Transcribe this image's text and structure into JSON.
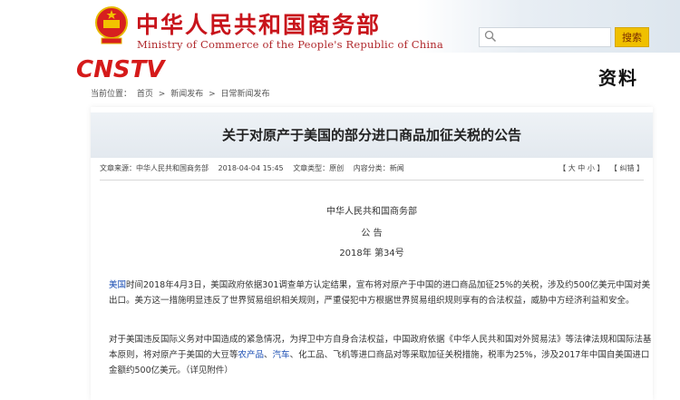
{
  "site": {
    "title": "中华人民共和国商务部",
    "subtitle": "Ministry of Commerce of the People's Republic of China"
  },
  "search": {
    "placeholder": "",
    "button_label": "搜索"
  },
  "overlay": {
    "logo_text": "CNSTV",
    "caption": "资料"
  },
  "breadcrumb": {
    "items": [
      "当前位置：",
      "首页",
      ">",
      "新闻发布",
      ">",
      "日常新闻发布"
    ]
  },
  "article": {
    "title": "关于对原产于美国的部分进口商品加征关税的公告",
    "meta": {
      "source": "文章来源：中华人民共和国商务部",
      "date": "2018-04-04 15:45",
      "type": "文章类型：原创",
      "category": "内容分类：新闻"
    },
    "tools": [
      "【 大 中 小 】",
      "【 纠错 】"
    ],
    "org": "中华人民共和国商务部",
    "heading": "公 告",
    "doc_no": "2018年 第34号",
    "p1_link": "美国",
    "p1_text": "时间2018年4月3日，美国政府依据301调查单方认定结果，宣布将对原产于中国的进口商品加征25%的关税，涉及约500亿美元中国对美出口。美方这一措施明显违反了世界贸易组织相关规则，严重侵犯中方根据世界贸易组织规则享有的合法权益，威胁中方经济利益和安全。",
    "p2_a": "对于美国违反国际义务对中国造成的紧急情况，为捍卫中方自身合法权益，中国政府依据《中华人民共和国对外贸易法》等法律法规和国际法基本原则，将对原产于美国的大豆等",
    "p2_link1": "农产品",
    "p2_b": "、",
    "p2_link2": "汽车",
    "p2_c": "、化工品、飞机等进口商品对等采取加征关税措施，税率为25%，涉及2017年中国自美国进口金额约500亿美元。（详见附件）"
  },
  "colors": {
    "brand_red": "#c8141b",
    "search_button": "#f0c000",
    "link_blue": "#1a4db3"
  },
  "icons": {
    "emblem": "national-emblem-icon",
    "search": "search-icon"
  }
}
